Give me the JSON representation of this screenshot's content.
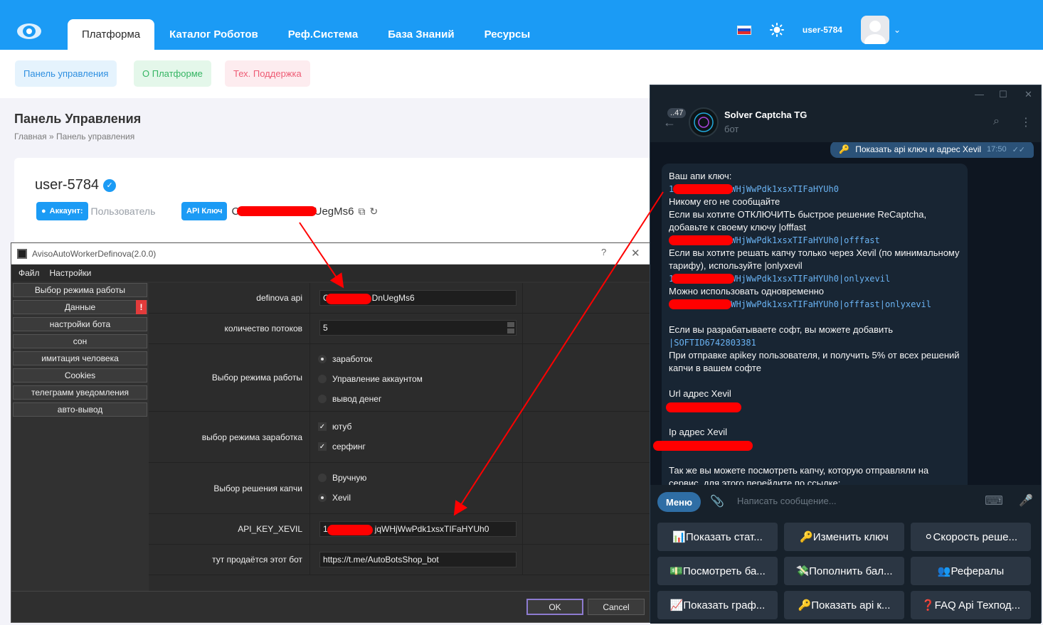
{
  "site": {
    "nav": [
      "Платформа",
      "Каталог Роботов",
      "Реф.Система",
      "База Знаний",
      "Ресурсы"
    ],
    "user": "user-5784",
    "subnav": [
      "Панель управления",
      "О Платформе",
      "Тех. Поддержка"
    ],
    "page_title": "Панель Управления",
    "breadcrumb": "Главная » Панель управления",
    "card": {
      "username": "user-5784",
      "account_label": "Аккаунт:",
      "account_value": "Пользователь",
      "api_label": "API Ключ",
      "api_value_start": "C",
      "api_value_end": "UegMs6"
    }
  },
  "qt": {
    "title": "AvisoAutoWorkerDefinova(2.0.0)",
    "help": "?",
    "menu": [
      "Файл",
      "Настройки"
    ],
    "side": [
      "Выбор режима работы",
      "Данные",
      "настройки бота",
      "сон",
      "имитация человека",
      "Cookies",
      "телеграмм уведомления",
      "авто-вывод"
    ],
    "warn_glyph": "!",
    "rows": {
      "definova_label": "definova api",
      "definova_value": "C",
      "definova_value_end": "DnUegMs6",
      "threads_label": "количество потоков",
      "threads_value": "5",
      "mode_label": "Выбор режима работы",
      "mode_options": [
        "заработок",
        "Управление аккаунтом",
        "вывод денег"
      ],
      "earn_label": "выбор режима заработка",
      "earn_options": [
        "ютуб",
        "серфинг"
      ],
      "captcha_label": "Выбор решения капчи",
      "captcha_options": [
        "Вручную",
        "Xevil"
      ],
      "xevil_label": "API_KEY_XEVIL",
      "xevil_value_start": "1",
      "xevil_value": "jqWHjWwPdk1xsxTIFaHYUh0",
      "shop_label": "тут продаётся этот бот",
      "shop_value": "https://t.me/AutoBotsShop_bot"
    },
    "ok": "OK",
    "cancel": "Cancel"
  },
  "telegram": {
    "unread": "..47",
    "bot_name": "Solver Captcha TG",
    "bot_sub": "бот",
    "out_msg": "Показать api ключ и адрес Xevil",
    "out_time": "17:50",
    "msg": {
      "l1": "Ваш апи ключ:",
      "k_start": "1",
      "k1": "WHjWwPdk1xsxTIFaHYUh0",
      "l2": "Никому его не сообщайте",
      "l3": "Если вы хотите ОТКЛЮЧИТЬ быстрое решение ReCaptcha, добавьте к своему ключу |offfast",
      "k2": "WHjWwPdk1xsxTIFaHYUh0|offfast",
      "l4": "Если вы хотите решать капчу только через Xevil (по минимальному тарифу), используйте |onlyxevil",
      "k3": "WHjWwPdk1xsxTIFaHYUh0|onlyxevil",
      "l5": "Можно использовать одновременно",
      "k4": "WHjWwPdk1xsxTIFaHYUh0|offfast|onlyxevil",
      "l6": "Если вы разрабатываете софт, вы можете добавить",
      "soft": "|SOFTID6742803381",
      "l7": "При отправке apikey пользователя, и получить 5% от всех решений капчи в вашем софте",
      "l8": "Url адрес Xevil",
      "l9": "Ip адрес Xevil",
      "l10": "Так же вы можете посмотреть капчу, которую отправляли на сервис, для этого перейдите по ссылке:"
    },
    "menu_btn": "Меню",
    "placeholder": "Написать сообщение...",
    "keyboard": [
      "📊Показать стат...",
      "🔑Изменить ключ",
      "⚪Скорость реше...",
      "💵Посмотреть ба...",
      "💸Пополнить бал...",
      "👥Рефералы",
      "📈Показать граф...",
      "🔑Показать api к...",
      "❓FAQ Api Техпод..."
    ]
  },
  "colors": {
    "accent": "#1b9bf5",
    "tg_bg": "#0e1621",
    "redaction": "#ff0000"
  }
}
